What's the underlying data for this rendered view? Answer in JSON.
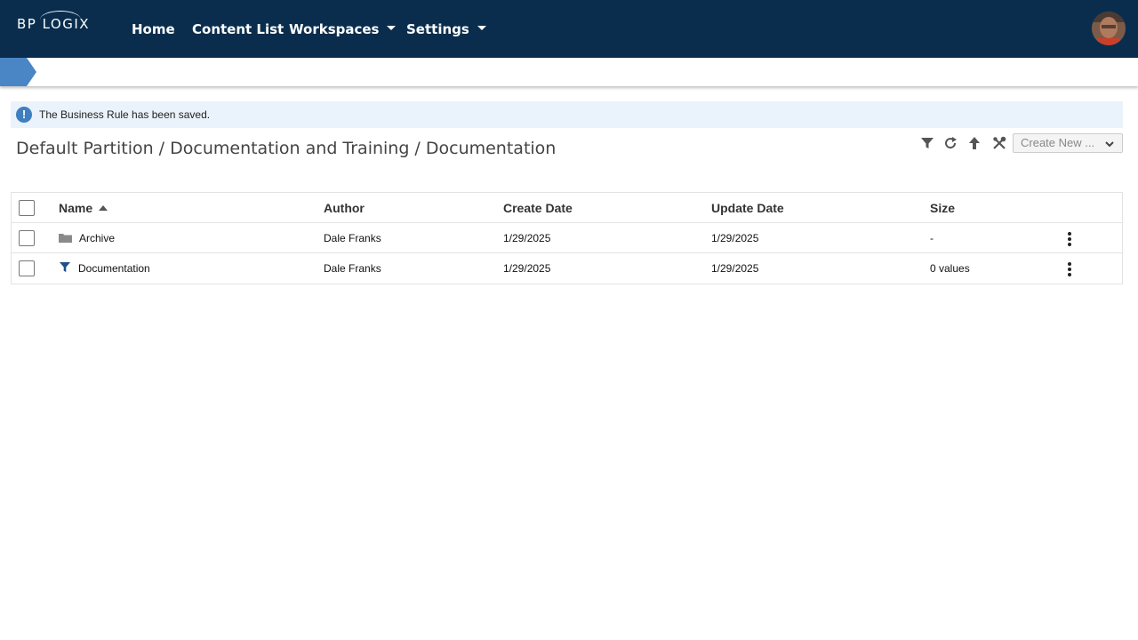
{
  "header": {
    "logo_text": "BP LOGIX",
    "nav": [
      {
        "label": "Home"
      },
      {
        "label": "Content List"
      },
      {
        "label": "Workspaces"
      },
      {
        "label": "Settings"
      }
    ]
  },
  "alert": {
    "text": "The Business Rule has been saved."
  },
  "page": {
    "title": "Default Partition / Documentation and Training / Documentation"
  },
  "toolbar": {
    "create_new_label": "Create New ..."
  },
  "table": {
    "columns": [
      "Name",
      "Author",
      "Create Date",
      "Update Date",
      "Size"
    ],
    "rows": [
      {
        "icon": "folder-icon",
        "name": "Archive",
        "author": "Dale Franks",
        "create_date": "1/29/2025",
        "update_date": "1/29/2025",
        "size": "-"
      },
      {
        "icon": "filter-icon",
        "name": "Documentation",
        "author": "Dale Franks",
        "create_date": "1/29/2025",
        "update_date": "1/29/2025",
        "size": "0 values"
      }
    ]
  },
  "colors": {
    "nav_bg": "#0a2d4d",
    "accent": "#3f7fbf",
    "alert_bg": "#eaf2fb"
  }
}
